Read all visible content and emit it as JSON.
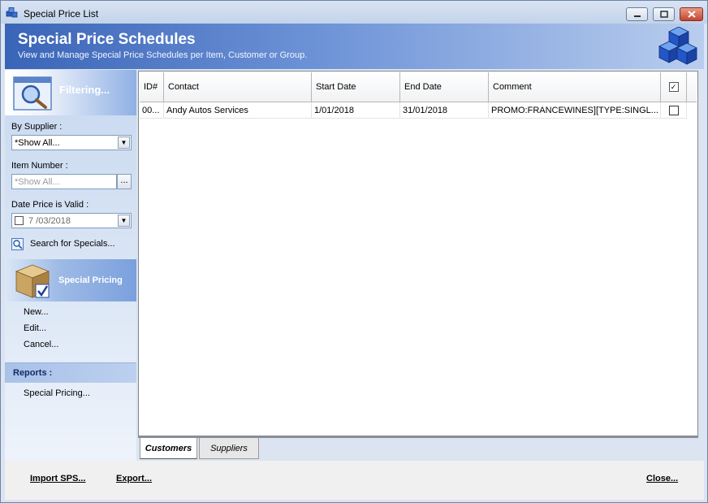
{
  "window": {
    "title": "Special Price List"
  },
  "banner": {
    "title": "Special Price Schedules",
    "subtitle": "View and Manage Special Price Schedules per Item, Customer or Group."
  },
  "filter": {
    "header": "Filtering...",
    "supplier_label": "By Supplier :",
    "supplier_value": "*Show All...",
    "item_label": "Item Number :",
    "item_placeholder": "*Show All...",
    "item_button": "...",
    "date_label": "Date Price is Valid :",
    "date_value": "7 /03/2018",
    "search_label": "Search for Specials..."
  },
  "special_pricing": {
    "header": "Special Pricing",
    "items": [
      "New...",
      "Edit...",
      "Cancel..."
    ]
  },
  "reports": {
    "header": "Reports :",
    "items": [
      "Special Pricing..."
    ]
  },
  "grid": {
    "columns": [
      "ID#",
      "Contact",
      "Start Date",
      "End Date",
      "Comment"
    ],
    "rows": [
      {
        "id": "00...",
        "contact": "Andy Autos Services",
        "start": "1/01/2018",
        "end": "31/01/2018",
        "comment": "PROMO:FRANCEWINES][TYPE:SINGL...",
        "checked": false
      }
    ]
  },
  "tabs": [
    "Customers",
    "Suppliers"
  ],
  "footer": {
    "import": "Import SPS...",
    "export": "Export...",
    "close": "Close..."
  }
}
